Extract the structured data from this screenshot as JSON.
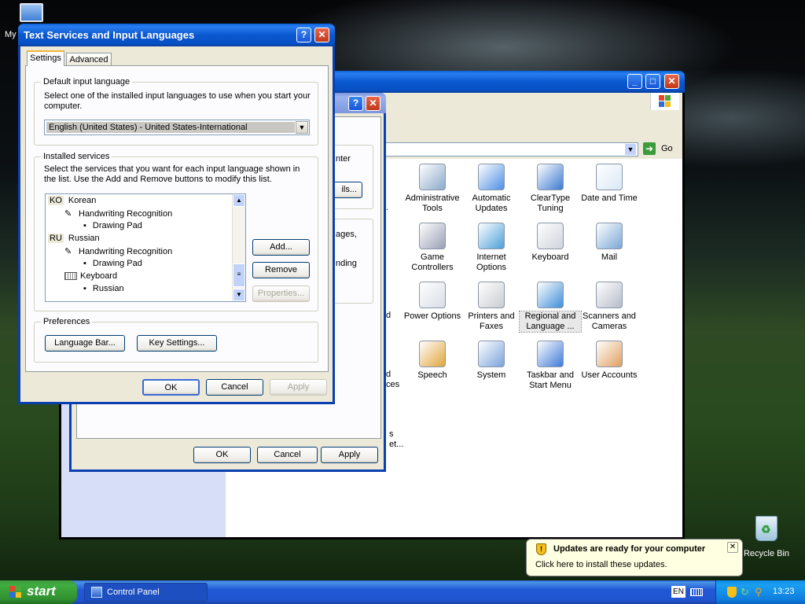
{
  "desktop": {
    "partial_icon_label": "My",
    "recycle_bin_label": "Recycle Bin"
  },
  "control_panel": {
    "go_label": "Go",
    "items": [
      {
        "label": "Administrative Tools",
        "icon": "admin-tools-icon"
      },
      {
        "label": "Automatic Updates",
        "icon": "automatic-updates-icon"
      },
      {
        "label": "ClearType Tuning",
        "icon": "cleartype-icon"
      },
      {
        "label": "Date and Time",
        "icon": "date-time-icon"
      },
      {
        "label": "Game Controllers",
        "icon": "game-controller-icon"
      },
      {
        "label": "Internet Options",
        "icon": "internet-options-icon"
      },
      {
        "label": "Keyboard",
        "icon": "keyboard-icon"
      },
      {
        "label": "Mail",
        "icon": "mail-icon"
      },
      {
        "label": "Power Options",
        "icon": "power-options-icon"
      },
      {
        "label": "Printers and Faxes",
        "icon": "printer-icon"
      },
      {
        "label": "Regional and Language ...",
        "icon": "globe-icon"
      },
      {
        "label": "Scanners and Cameras",
        "icon": "scanner-icon"
      },
      {
        "label": "Speech",
        "icon": "speech-icon"
      },
      {
        "label": "System",
        "icon": "system-icon"
      },
      {
        "label": "Taskbar and Start Menu",
        "icon": "taskbar-icon"
      },
      {
        "label": "User Accounts",
        "icon": "user-accounts-icon"
      }
    ],
    "left_fragments": [
      ".",
      "d",
      "d",
      "ces"
    ]
  },
  "regional_dialog": {
    "partial_texts": [
      "nter",
      "ils...",
      "ages,",
      "nding",
      "s",
      "et..."
    ],
    "ok": "OK",
    "cancel": "Cancel",
    "apply": "Apply"
  },
  "tsil_dialog": {
    "title": "Text Services and Input Languages",
    "tabs": [
      "Settings",
      "Advanced"
    ],
    "default_input": {
      "group_label": "Default input language",
      "description": "Select one of the installed input languages to use when you start your computer.",
      "selected": "English (United States) - United States-International"
    },
    "installed": {
      "group_label": "Installed services",
      "description": "Select the services that you want for each input language shown in the list. Use the Add and Remove buttons to modify this list.",
      "rows": [
        {
          "code": "KO",
          "text": "Korean"
        },
        {
          "text": "Handwriting Recognition"
        },
        {
          "text": "Drawing Pad"
        },
        {
          "code": "RU",
          "text": "Russian"
        },
        {
          "text": "Handwriting Recognition"
        },
        {
          "text": "Drawing Pad"
        },
        {
          "text": "Keyboard"
        },
        {
          "text": "Russian"
        }
      ],
      "add": "Add...",
      "remove": "Remove",
      "properties": "Properties..."
    },
    "preferences": {
      "group_label": "Preferences",
      "language_bar": "Language Bar...",
      "key_settings": "Key Settings..."
    },
    "ok": "OK",
    "cancel": "Cancel",
    "apply": "Apply"
  },
  "notification": {
    "title": "Updates are ready for your computer",
    "body": "Click here to install these updates."
  },
  "taskbar": {
    "start": "start",
    "task": "Control Panel",
    "lang": "EN",
    "clock": "13:23"
  }
}
